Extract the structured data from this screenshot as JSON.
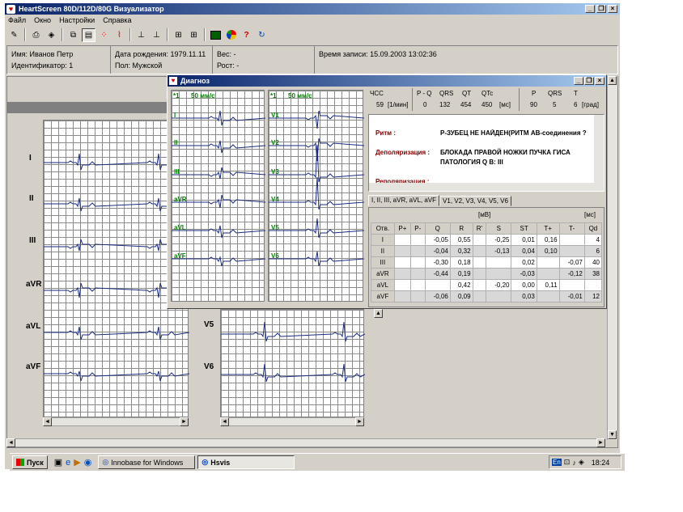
{
  "app": {
    "title": "HeartScreen 80D/112D/80G Визуализатор",
    "icon": "heart-icon"
  },
  "menu": [
    "Файл",
    "Окно",
    "Настройки",
    "Справка"
  ],
  "toolbar": {
    "icons": [
      "edit-icon",
      "print-icon",
      "erase-icon",
      "copy-icon",
      "leads-grid-icon",
      "leads-dots-icon",
      "ecg-wave-icon",
      "ruler-icon",
      "ruler-icon-2",
      "grid-icon",
      "grid-icon-2",
      "monitor-icon",
      "pie-chart-icon",
      "help-icon",
      "refresh-icon"
    ]
  },
  "patient": {
    "name": "Имя: Иванов Петр",
    "id": "Идентификатор: 1",
    "dob": "Дата рождения: 1979.11.11",
    "sex": "Пол: Мужской",
    "weight": "Вес: -",
    "height": "Рост: -",
    "record_time": "Время записи: 15.09.2003 13:02:36"
  },
  "leads_left": [
    "I",
    "II",
    "III",
    "aVR",
    "aVL",
    "aVF"
  ],
  "leads_right": [
    "V5",
    "V6"
  ],
  "dialog": {
    "title": "Диагноз",
    "speed_label": "50 мм/с",
    "marker": "*1",
    "limb_leads": [
      "I",
      "II",
      "III",
      "aVR",
      "aVL",
      "aVF"
    ],
    "chest_leads": [
      "V1",
      "V2",
      "V3",
      "V4",
      "V5",
      "V6"
    ],
    "summary": {
      "hr_label": "ЧСС",
      "hr_value": "59",
      "hr_unit": "[1/мин]",
      "interval_headers": [
        "P - Q",
        "QRS",
        "QT",
        "QTc"
      ],
      "interval_values": [
        "0",
        "132",
        "454",
        "450"
      ],
      "interval_unit": "[мс]",
      "axis_headers": [
        "P",
        "QRS",
        "T"
      ],
      "axis_values": [
        "90",
        "5",
        "6"
      ],
      "axis_unit": "[град]"
    },
    "diagnosis": {
      "rhythm_label": "Ритм :",
      "rhythm_value": "Р-ЗУБЕЦ НЕ НАЙДЕН(РИТМ АВ-соединения ?",
      "depol_label": "Деполяризация :",
      "depol_value1": "БЛОКАДА ПРАВОЙ НОЖКИ ПУЧКА ГИСА",
      "depol_value2": "ПАТОЛОГИЯ Q В: III",
      "repol_label": "Реполяризация :"
    },
    "tabs": [
      "I, II, III, aVR, aVL, aVF",
      "V1, V2, V3, V4, V5, V6"
    ],
    "table": {
      "unit_mv": "[мВ]",
      "unit_ms": "[мс]",
      "headers": [
        "Отв.",
        "P+",
        "P-",
        "Q",
        "R",
        "R'",
        "S",
        "ST",
        "T+",
        "T-",
        "Qd"
      ],
      "rows": [
        [
          "I",
          "",
          "",
          "-0,05",
          "0,55",
          "",
          "-0,25",
          "0,01",
          "0,16",
          "",
          "4"
        ],
        [
          "II",
          "",
          "",
          "-0,04",
          "0,32",
          "",
          "-0,13",
          "0,04",
          "0,10",
          "",
          "6"
        ],
        [
          "III",
          "",
          "",
          "-0,30",
          "0,18",
          "",
          "",
          "0,02",
          "",
          "-0,07",
          "40"
        ],
        [
          "aVR",
          "",
          "",
          "-0,44",
          "0,19",
          "",
          "",
          "-0,03",
          "",
          "-0,12",
          "38"
        ],
        [
          "aVL",
          "",
          "",
          "",
          "0,42",
          "",
          "-0,20",
          "0,00",
          "0,11",
          "",
          ""
        ],
        [
          "aVF",
          "",
          "",
          "-0,06",
          "0,09",
          "",
          "",
          "0,03",
          "",
          "-0,01",
          "12"
        ]
      ]
    }
  },
  "taskbar": {
    "start": "Пуск",
    "tasks": [
      "Innobase for Windows",
      "Hsvis"
    ],
    "clock": "18:24",
    "lang": "En"
  }
}
